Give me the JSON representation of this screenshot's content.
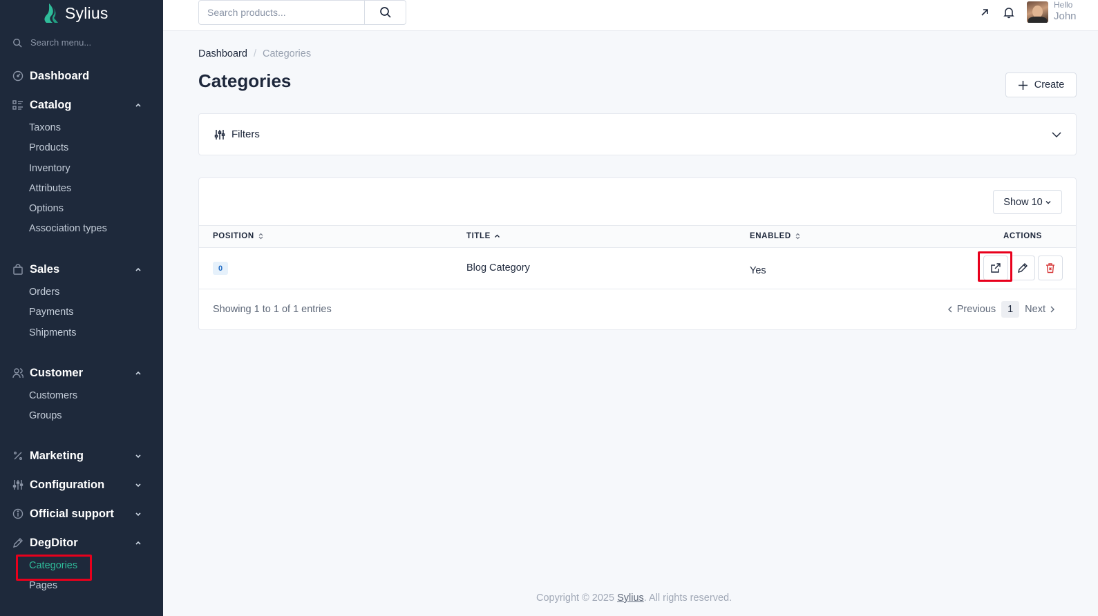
{
  "brand": {
    "name": "Sylius"
  },
  "sidebar": {
    "search_placeholder": "Search menu...",
    "sections": [
      {
        "label": "Dashboard",
        "icon": "dashboard-icon"
      },
      {
        "label": "Catalog",
        "icon": "catalog-icon",
        "expanded": true,
        "items": [
          "Taxons",
          "Products",
          "Inventory",
          "Attributes",
          "Options",
          "Association types"
        ]
      },
      {
        "label": "Sales",
        "icon": "bag-icon",
        "expanded": true,
        "items": [
          "Orders",
          "Payments",
          "Shipments"
        ]
      },
      {
        "label": "Customer",
        "icon": "users-icon",
        "expanded": true,
        "items": [
          "Customers",
          "Groups"
        ]
      },
      {
        "label": "Marketing",
        "icon": "percent-icon",
        "expanded": false
      },
      {
        "label": "Configuration",
        "icon": "sliders-icon",
        "expanded": false
      },
      {
        "label": "Official support",
        "icon": "info-icon",
        "expanded": false
      },
      {
        "label": "DegDitor",
        "icon": "pencil-icon",
        "expanded": true,
        "items": [
          "Categories",
          "Pages"
        ],
        "active_item": "Categories"
      }
    ]
  },
  "topbar": {
    "search_placeholder": "Search products...",
    "greeting": "Hello",
    "user_name": "John"
  },
  "breadcrumb": {
    "home": "Dashboard",
    "current": "Categories"
  },
  "page": {
    "title": "Categories",
    "create_label": "Create"
  },
  "filters": {
    "label": "Filters"
  },
  "table": {
    "show_label": "Show 10",
    "columns": {
      "position": "POSITION",
      "title": "TITLE",
      "enabled": "ENABLED",
      "actions": "ACTIONS"
    },
    "rows": [
      {
        "position": "0",
        "title": "Blog Category",
        "enabled": "Yes"
      }
    ],
    "info": "Showing 1 to 1 of 1 entries",
    "pagination": {
      "previous": "Previous",
      "current": "1",
      "next": "Next"
    }
  },
  "footer": {
    "prefix": "Copyright © 2025 ",
    "link": "Sylius",
    "suffix": ". All rights reserved."
  },
  "colors": {
    "sidebar_bg": "#1e293b",
    "accent": "#2fbc9a",
    "highlight": "#e8001c",
    "delete": "#d63939"
  }
}
